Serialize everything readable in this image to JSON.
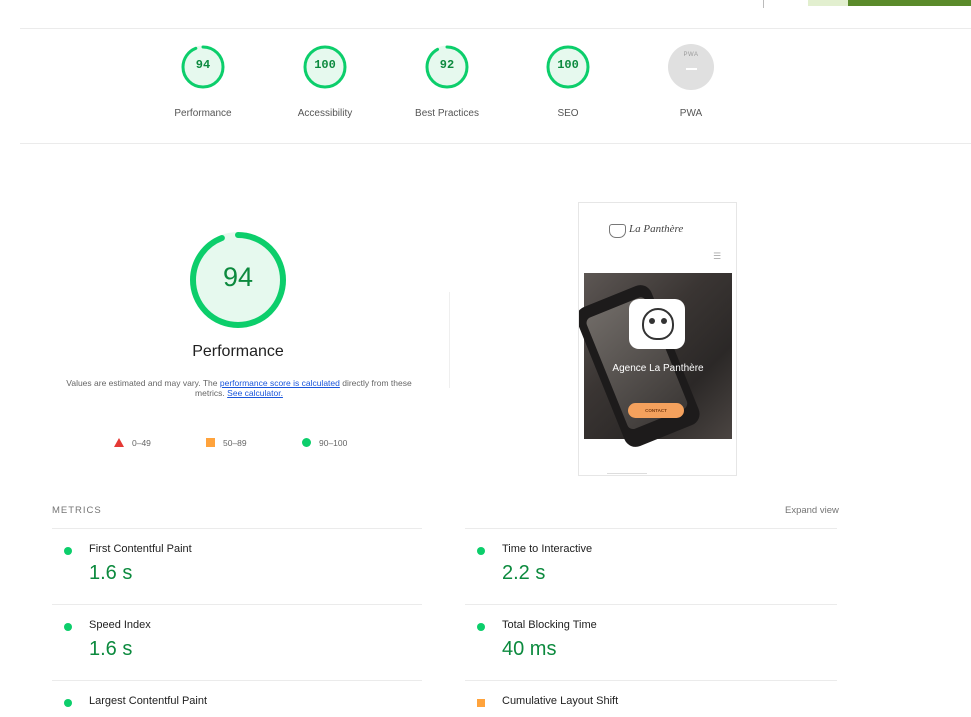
{
  "colors": {
    "pass": "#0cce6b",
    "pass_text": "#0c8a3e",
    "average": "#ffa33c",
    "fail": "#e53935",
    "link": "#1a56db"
  },
  "gauges": [
    {
      "value": "94",
      "score": 0.94,
      "label": "Performance"
    },
    {
      "value": "100",
      "score": 1.0,
      "label": "Accessibility"
    },
    {
      "value": "92",
      "score": 0.92,
      "label": "Best Practices"
    },
    {
      "value": "100",
      "score": 1.0,
      "label": "SEO"
    },
    {
      "value": "",
      "label": "PWA",
      "badge": "PWA"
    }
  ],
  "performance": {
    "score_text": "94",
    "score": 0.94,
    "title": "Performance",
    "desc_prefix": "Values are estimated and may vary. The ",
    "desc_link1": "performance score is calculated",
    "desc_middle": " directly from these metrics. ",
    "desc_link2": "See calculator."
  },
  "legend": [
    {
      "range": "0–49",
      "shape": "triangle"
    },
    {
      "range": "50–89",
      "shape": "square"
    },
    {
      "range": "90–100",
      "shape": "circle"
    }
  ],
  "screenshot": {
    "brand": "La Panthère",
    "hero_title": "Agence La Panthère",
    "cta": "CONTACT"
  },
  "metrics": {
    "heading": "METRICS",
    "expand_label": "Expand view",
    "items": [
      {
        "label": "First Contentful Paint",
        "value": "1.6 s",
        "status": "pass"
      },
      {
        "label": "Time to Interactive",
        "value": "2.2 s",
        "status": "pass"
      },
      {
        "label": "Speed Index",
        "value": "1.6 s",
        "status": "pass"
      },
      {
        "label": "Total Blocking Time",
        "value": "40 ms",
        "status": "pass"
      },
      {
        "label": "Largest Contentful Paint",
        "value": "",
        "status": "pass"
      },
      {
        "label": "Cumulative Layout Shift",
        "value": "",
        "status": "average"
      }
    ]
  }
}
